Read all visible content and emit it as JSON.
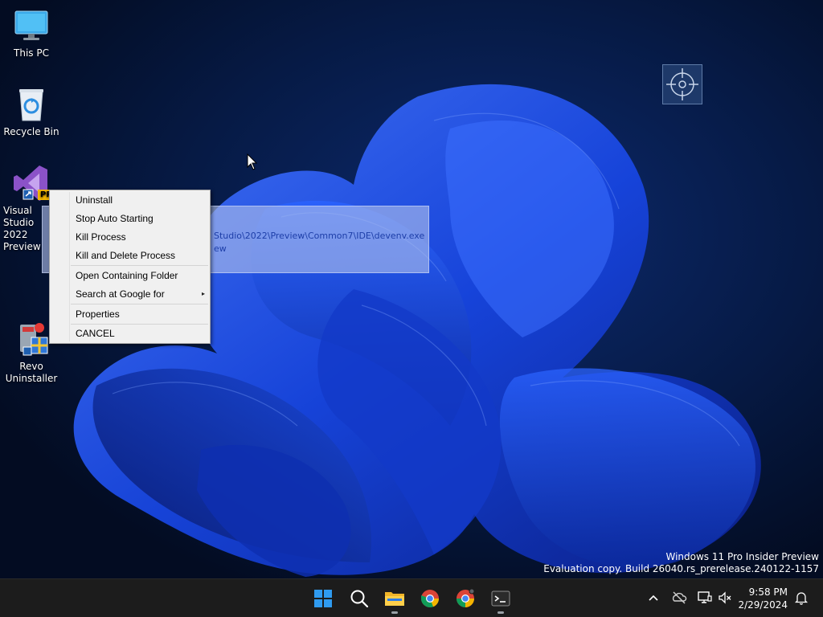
{
  "desktop_icons": [
    {
      "name": "this-pc",
      "label": "This PC",
      "icon": "monitor-icon"
    },
    {
      "name": "recycle-bin",
      "label": "Recycle Bin",
      "icon": "recycle-bin-icon"
    },
    {
      "name": "visual-studio",
      "label_line1": "Visual Studio",
      "label_line2": "2022 Preview",
      "badge": "PRE",
      "icon": "visual-studio-icon"
    },
    {
      "name": "revo-uninstaller",
      "label_line1": "Revo",
      "label_line2": "Uninstaller",
      "icon": "revo-uninstaller-icon"
    }
  ],
  "tooltip": {
    "path_line1": "Studio\\2022\\Preview\\Common7\\IDE\\devenv.exe",
    "path_line2": "ew"
  },
  "context_menu": {
    "items": [
      {
        "label": "Uninstall"
      },
      {
        "label": "Stop Auto Starting"
      },
      {
        "label": "Kill Process"
      },
      {
        "label": "Kill and Delete Process"
      },
      {
        "label": "Open Containing Folder"
      },
      {
        "label": "Search at Google for",
        "submenu": true
      },
      {
        "label": "Properties"
      },
      {
        "label": "CANCEL"
      }
    ],
    "submenu_arrow": "▸"
  },
  "watermark": {
    "line1": "Windows 11 Pro Insider Preview",
    "line2": "Evaluation copy. Build 26040.rs_prerelease.240122-1157"
  },
  "taskbar": {
    "apps": [
      {
        "name": "start",
        "icon": "windows-start-icon"
      },
      {
        "name": "search",
        "icon": "search-icon"
      },
      {
        "name": "file-explorer",
        "icon": "folder-icon",
        "running": true
      },
      {
        "name": "chrome",
        "icon": "chrome-icon",
        "running": false
      },
      {
        "name": "chrome-canary",
        "icon": "chrome-alt-icon",
        "running": false
      },
      {
        "name": "terminal",
        "icon": "terminal-icon",
        "running": true
      }
    ],
    "tray": [
      "chevron-up-icon",
      "onedrive-offline-icon",
      "network-icon",
      "speaker-muted-icon"
    ],
    "time": "9:58 PM",
    "date": "2/29/2024",
    "notification_icon": "bell-icon"
  },
  "colors": {
    "menu_bg": "#f0f0f0",
    "taskbar_bg": "#1c1c1c",
    "accent": "#1e6bff",
    "tooltip_text": "#1d3ea8"
  }
}
